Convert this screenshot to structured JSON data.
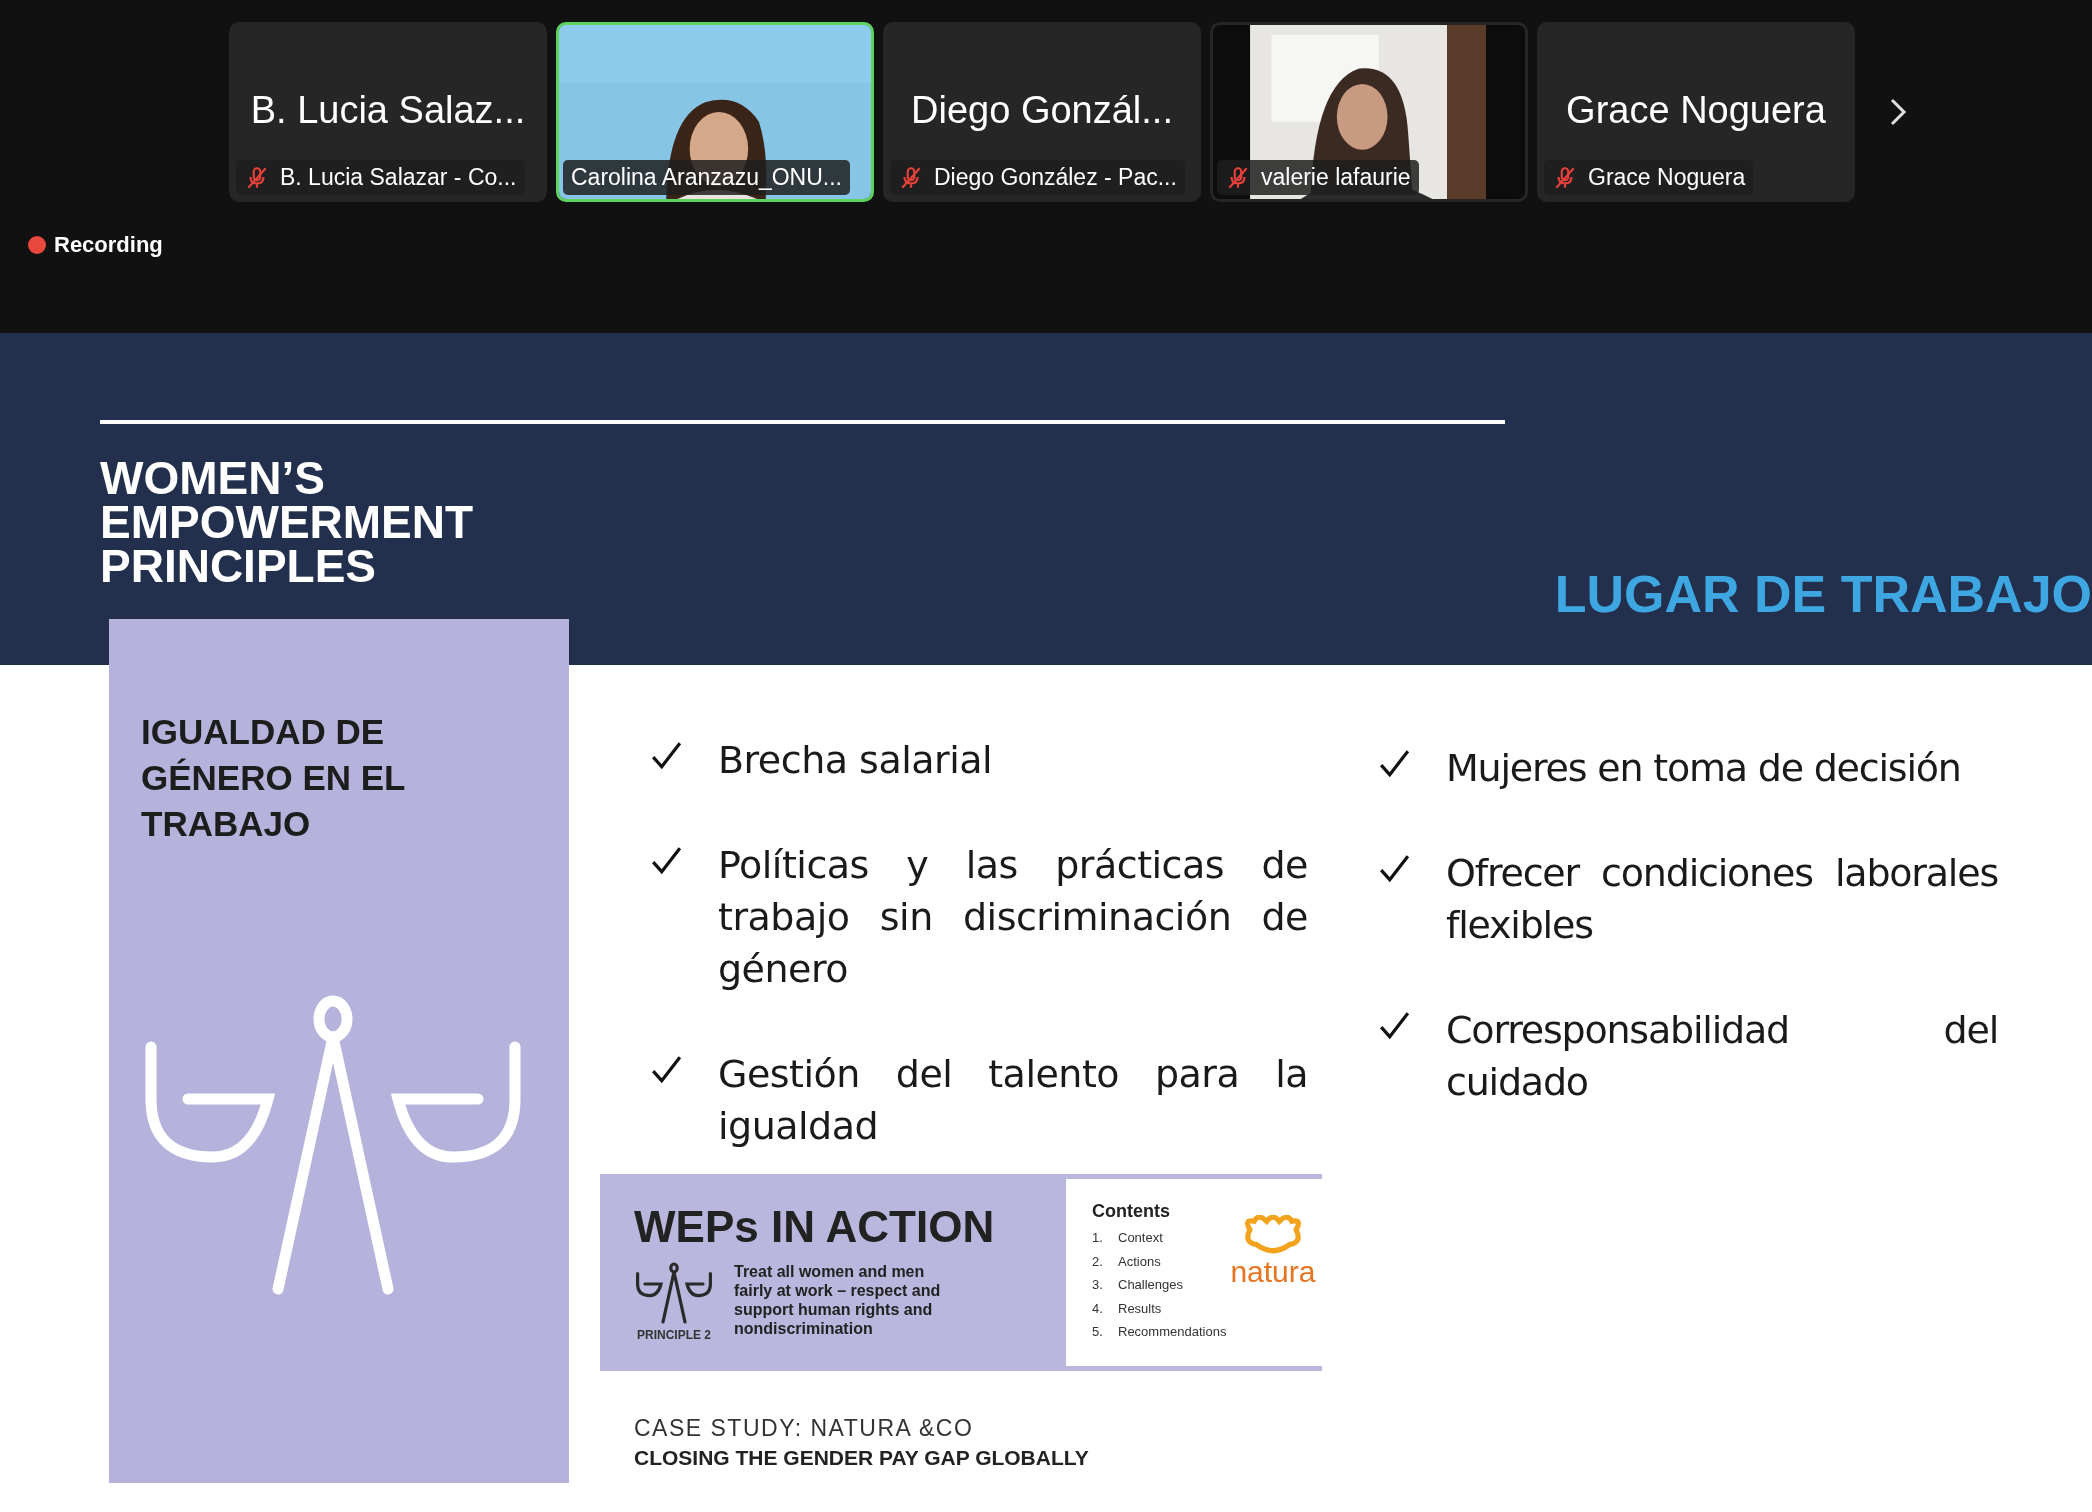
{
  "participants": [
    {
      "kind": "name",
      "display_name": "B. Lucia Salaz...",
      "label": "B. Lucia Salazar - Co...",
      "muted": true,
      "active_speaker": false
    },
    {
      "kind": "video",
      "label": "Carolina Aranzazu_ONU...",
      "muted": false,
      "active_speaker": true
    },
    {
      "kind": "name",
      "display_name": "Diego Gonzál...",
      "label": "Diego González - Pac...",
      "muted": true,
      "active_speaker": false
    },
    {
      "kind": "webcam",
      "label": "valerie lafaurie",
      "muted": true,
      "active_speaker": false
    },
    {
      "kind": "name",
      "display_name": "Grace Noguera",
      "label": "Grace Noguera",
      "muted": true,
      "active_speaker": false
    }
  ],
  "recording": {
    "label": "Recording"
  },
  "slide": {
    "title_lines": [
      "WOMEN’S",
      "EMPOWERMENT",
      "PRINCIPLES"
    ],
    "section": "LUGAR DE TRABAJO",
    "card": {
      "heading_lines": [
        "IGUALDAD DE",
        "GÉNERO EN EL",
        "TRABAJO"
      ]
    },
    "bullet_columns": [
      [
        "Brecha salarial",
        "Políticas y las prácticas de trabajo sin discriminación de género",
        "Gestión del talento para la igualdad"
      ],
      [
        "Mujeres en toma de decisión",
        "Ofrecer condiciones laborales flexibles",
        "Corresponsabilidad del cuidado"
      ]
    ],
    "weps": {
      "title": "WEPs IN ACTION",
      "principle": "PRINCIPLE 2",
      "description": "Treat all women and men fairly at work – respect and support human rights and nondiscrimination",
      "contents_title": "Contents",
      "contents": [
        {
          "number": "1.",
          "text": "Context"
        },
        {
          "number": "2.",
          "text": "Actions"
        },
        {
          "number": "3.",
          "text": "Challenges"
        },
        {
          "number": "4.",
          "text": "Results"
        },
        {
          "number": "5.",
          "text": "Recommendations"
        }
      ],
      "brand": "natura"
    },
    "case_study": {
      "line1": "CASE STUDY: NATURA &CO",
      "line2": "CLOSING THE GENDER PAY GAP GLOBALLY"
    }
  }
}
